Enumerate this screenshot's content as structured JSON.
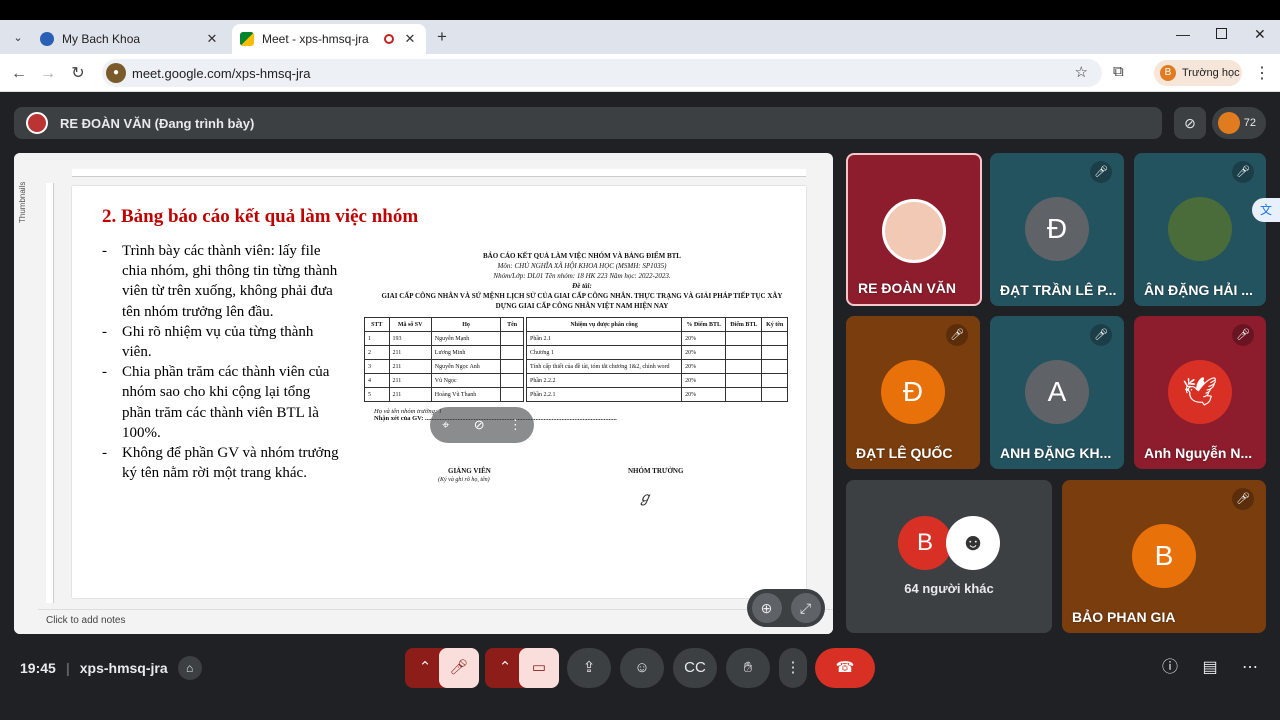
{
  "browser": {
    "tabs": [
      {
        "title": "My Bach Khoa",
        "active": false
      },
      {
        "title": "Meet - xps-hmsq-jra",
        "active": true
      }
    ],
    "url": "meet.google.com/xps-hmsq-jra",
    "profile_initial": "B",
    "profile_label": "Trường học"
  },
  "meet": {
    "presenter_label": "RE ĐOÀN VĂN (Đang trình bày)",
    "participant_count": "72",
    "time": "19:45",
    "meeting_code": "xps-hmsq-jra",
    "others_label": "64 người khác",
    "others_initial": "B"
  },
  "presentation": {
    "thumbnails_label": "Thumbnails",
    "notes_placeholder": "Click to add notes",
    "slide_title": "2. Bảng báo cáo kết quả làm việc nhóm",
    "bullets": [
      "Trình bày các thành viên: lấy file chia nhóm, ghi thông tin từng thành viên từ trên xuống, không phải đưa tên nhóm trưởng lên đầu.",
      "Ghi rõ nhiệm vụ của từng thành viên.",
      "Chia phần trăm các thành viên của nhóm sao cho khi cộng lại tổng phần trăm các thành viên BTL là 100%.",
      "Không để phần GV và nhóm trưởng ký tên nằm rời một trang khác."
    ],
    "doc": {
      "heading": "BÁO CÁO KẾT QUẢ LÀM VIỆC NHÓM VÀ BẢNG ĐIỂM BTL",
      "subject": "Môn: CHỦ NGHĨA XÃ HỘI KHOA HỌC  (MSMH: SP1035)",
      "class_line": "Nhóm/Lớp: DL01   Tên nhóm: 18   HK 223   Năm học: 2022-2023.",
      "topic_label": "Đề tài:",
      "topic": "GIAI CẤP CÔNG NHÂN VÀ SỨ MỆNH LỊCH SỬ CỦA GIAI CẤP CÔNG NHÂN. THỰC TRẠNG VÀ GIẢI PHÁP TIẾP TỤC XÂY DỰNG GIAI CẤP CÔNG NHÂN VIỆT NAM HIỆN NAY",
      "left_headers": [
        "STT",
        "Mã số SV",
        "Họ",
        "Tên"
      ],
      "right_headers": [
        "Nhiệm vụ được phân công",
        "% Điểm BTL",
        "Điểm BTL",
        "Ký tên"
      ],
      "rows": [
        {
          "stt": "1",
          "mssv": "193",
          "ho": "Nguyễn Mạnh",
          "task": "Phần 2.1",
          "pct": "20%"
        },
        {
          "stt": "2",
          "mssv": "211",
          "ho": "Lương Minh",
          "task": "Chương 1",
          "pct": "20%"
        },
        {
          "stt": "3",
          "mssv": "211",
          "ho": "Nguyễn Ngọc Anh",
          "task": "Tính cấp thiết của đề tài, tóm tắt chương 1&2, chỉnh word",
          "pct": "20%"
        },
        {
          "stt": "4",
          "mssv": "211",
          "ho": "Vũ Ngọc",
          "task": "Phần 2.2.2",
          "pct": "20%"
        },
        {
          "stt": "5",
          "mssv": "211",
          "ho": "Hoàng Vũ Thanh",
          "task": "Phần 2.2.1",
          "pct": "20%"
        }
      ],
      "leader_line": "Họ và tên nhóm trưởng: 1",
      "teacher_comment": "Nhận xét của GV: ......................................................................................................................",
      "teacher_label": "GIẢNG VIÊN",
      "teacher_note": "(Ký và ghi rõ họ, tên)",
      "leader_label": "NHÓM TRƯỞNG"
    }
  },
  "tiles": [
    {
      "name": "RE ĐOÀN VĂN",
      "initial": "",
      "color": "#8d1d2c",
      "muted": false
    },
    {
      "name": "ĐẠT TRẦN LÊ P...",
      "initial": "Đ",
      "color": "#245360",
      "muted": true
    },
    {
      "name": "ÂN ĐẶNG HẢI ...",
      "initial": "",
      "color": "#245360",
      "muted": true
    },
    {
      "name": "ĐẠT LÊ QUỐC",
      "initial": "Đ",
      "color": "#7a3d0e",
      "muted": true
    },
    {
      "name": "ANH ĐẶNG KH...",
      "initial": "A",
      "color": "#245360",
      "muted": true
    },
    {
      "name": "Anh Nguyễn N...",
      "initial": "",
      "color": "#8d1d2c",
      "muted": true
    },
    {
      "name": "BẢO PHAN GIA",
      "initial": "B",
      "color": "#7a3d0e",
      "muted": true
    }
  ]
}
